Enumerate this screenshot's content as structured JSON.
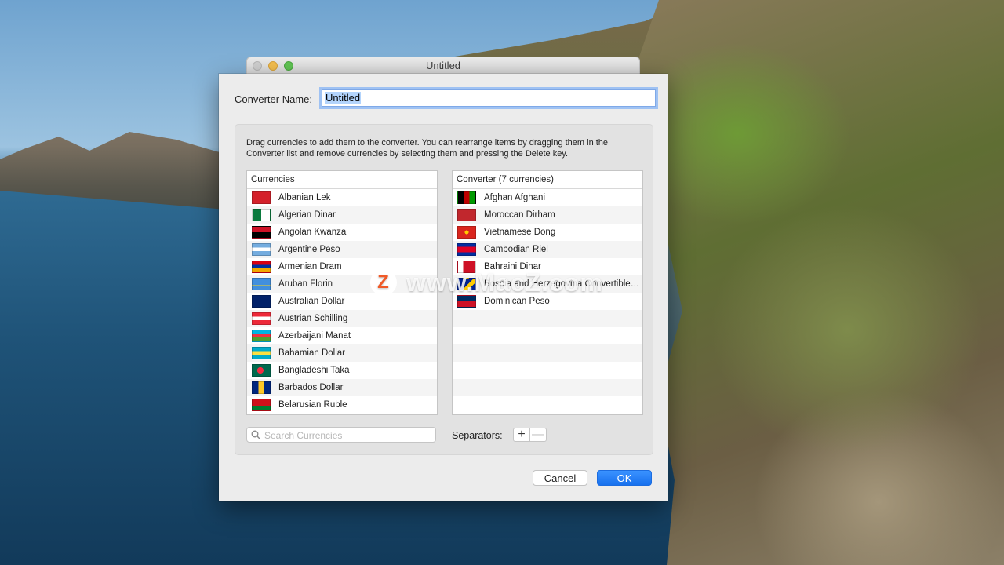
{
  "window": {
    "title": "Untitled"
  },
  "form": {
    "name_label": "Converter Name:",
    "name_value": "Untitled"
  },
  "instructions": "Drag currencies to add them to the converter. You can rearrange items by dragging them in the Converter list and remove currencies by selecting them and pressing the Delete key.",
  "currencies": {
    "header": "Currencies",
    "items": [
      {
        "label": "Albanian Lek",
        "icon": "flag-albania"
      },
      {
        "label": "Algerian Dinar",
        "icon": "flag-algeria"
      },
      {
        "label": "Angolan Kwanza",
        "icon": "flag-angola"
      },
      {
        "label": "Argentine Peso",
        "icon": "flag-argentina"
      },
      {
        "label": "Armenian Dram",
        "icon": "flag-armenia"
      },
      {
        "label": "Aruban Florin",
        "icon": "flag-aruba"
      },
      {
        "label": "Australian Dollar",
        "icon": "flag-australia"
      },
      {
        "label": "Austrian Schilling",
        "icon": "flag-austria"
      },
      {
        "label": "Azerbaijani Manat",
        "icon": "flag-azerbaijan"
      },
      {
        "label": "Bahamian Dollar",
        "icon": "flag-bahamas"
      },
      {
        "label": "Bangladeshi Taka",
        "icon": "flag-bangladesh"
      },
      {
        "label": "Barbados Dollar",
        "icon": "flag-barbados"
      },
      {
        "label": "Belarusian Ruble",
        "icon": "flag-belarus"
      }
    ]
  },
  "converter": {
    "header": "Converter (7 currencies)",
    "items": [
      {
        "label": "Afghan Afghani",
        "icon": "flag-afghanistan"
      },
      {
        "label": "Moroccan Dirham",
        "icon": "flag-morocco"
      },
      {
        "label": "Vietnamese Dong",
        "icon": "flag-vietnam"
      },
      {
        "label": "Cambodian Riel",
        "icon": "flag-cambodia"
      },
      {
        "label": "Bahraini Dinar",
        "icon": "flag-bahrain"
      },
      {
        "label": "Bosnia and Herzegovina Convertible…",
        "icon": "flag-bosnia"
      },
      {
        "label": "Dominican Peso",
        "icon": "flag-dominican-republic"
      }
    ]
  },
  "search": {
    "placeholder": "Search Currencies",
    "icon": "search-icon"
  },
  "separators": {
    "label": "Separators:",
    "add": "+",
    "remove": "—"
  },
  "buttons": {
    "cancel": "Cancel",
    "ok": "OK"
  },
  "watermark": {
    "text": "www.MacZ.com",
    "logo": "Z"
  },
  "colors": {
    "accent": "#1a73ef",
    "focus_ring": "#9fc2f3"
  }
}
